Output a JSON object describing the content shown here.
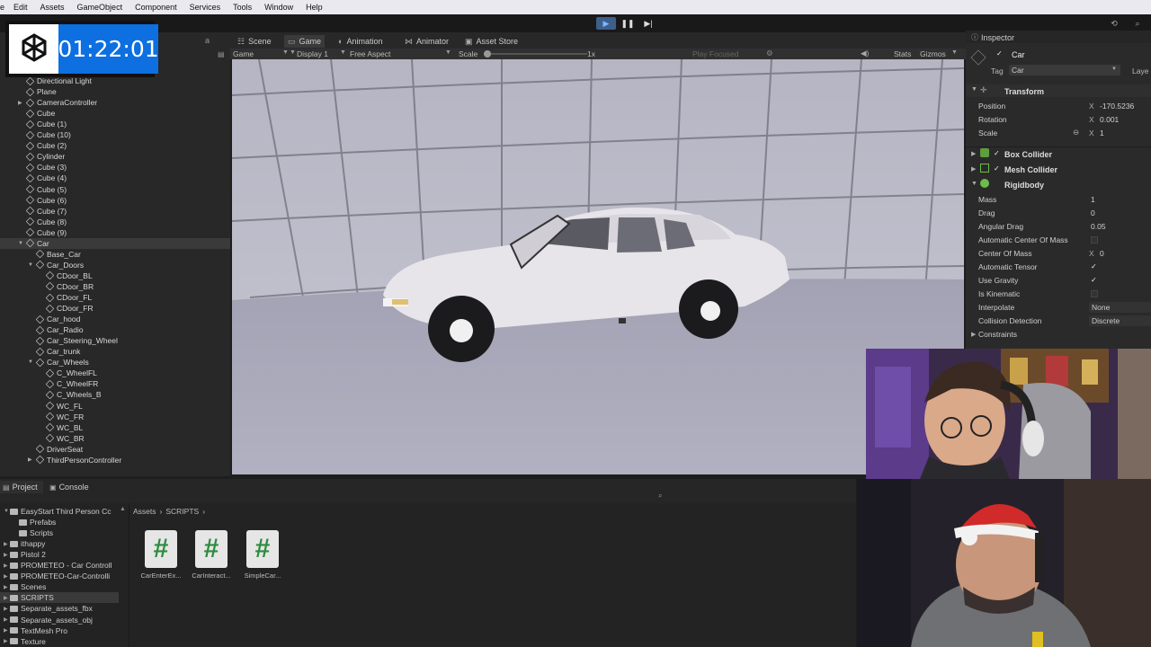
{
  "menu": [
    "e",
    "Edit",
    "Assets",
    "GameObject",
    "Component",
    "Services",
    "Tools",
    "Window",
    "Help"
  ],
  "timer": {
    "value": "01:22:01",
    "logo_icon": "openai-logo-icon"
  },
  "tabs": {
    "scene": "Scene",
    "game": "Game",
    "animation": "Animation",
    "animator": "Animator",
    "asset_store": "Asset Store"
  },
  "gamebar": {
    "game": "Game",
    "display": "Display 1",
    "aspect": "Free Aspect",
    "scale_label": "Scale",
    "scale_value": "1x",
    "play_focused": "Play Focused",
    "stats": "Stats",
    "gizmos": "Gizmos"
  },
  "hierarchy": [
    {
      "label": "Directional Light",
      "indent": 0
    },
    {
      "label": "Plane",
      "indent": 0
    },
    {
      "label": "CameraController",
      "indent": 0,
      "arrow": true
    },
    {
      "label": "Cube",
      "indent": 0
    },
    {
      "label": "Cube (1)",
      "indent": 0
    },
    {
      "label": "Cube (10)",
      "indent": 0
    },
    {
      "label": "Cube (2)",
      "indent": 0
    },
    {
      "label": "Cylinder",
      "indent": 0
    },
    {
      "label": "Cube (3)",
      "indent": 0
    },
    {
      "label": "Cube (4)",
      "indent": 0
    },
    {
      "label": "Cube (5)",
      "indent": 0
    },
    {
      "label": "Cube (6)",
      "indent": 0
    },
    {
      "label": "Cube (7)",
      "indent": 0
    },
    {
      "label": "Cube (8)",
      "indent": 0
    },
    {
      "label": "Cube (9)",
      "indent": 0
    },
    {
      "label": "Car",
      "indent": 0,
      "arrow": true,
      "open": true,
      "selected": true
    },
    {
      "label": "Base_Car",
      "indent": 1
    },
    {
      "label": "Car_Doors",
      "indent": 1,
      "arrow": true,
      "open": true
    },
    {
      "label": "CDoor_BL",
      "indent": 2
    },
    {
      "label": "CDoor_BR",
      "indent": 2
    },
    {
      "label": "CDoor_FL",
      "indent": 2
    },
    {
      "label": "CDoor_FR",
      "indent": 2
    },
    {
      "label": "Car_hood",
      "indent": 1
    },
    {
      "label": "Car_Radio",
      "indent": 1
    },
    {
      "label": "Car_Steering_Wheel",
      "indent": 1
    },
    {
      "label": "Car_trunk",
      "indent": 1
    },
    {
      "label": "Car_Wheels",
      "indent": 1,
      "arrow": true,
      "open": true
    },
    {
      "label": "C_WheelFL",
      "indent": 2
    },
    {
      "label": "C_WheelFR",
      "indent": 2
    },
    {
      "label": "C_Wheels_B",
      "indent": 2
    },
    {
      "label": "WC_FL",
      "indent": 2
    },
    {
      "label": "WC_FR",
      "indent": 2
    },
    {
      "label": "WC_BL",
      "indent": 2
    },
    {
      "label": "WC_BR",
      "indent": 2
    },
    {
      "label": "DriverSeat",
      "indent": 1
    },
    {
      "label": "ThirdPersonController",
      "indent": 1,
      "arrow": true
    }
  ],
  "inspector": {
    "title": "Inspector",
    "object_name": "Car",
    "tag_label": "Tag",
    "tag_value": "Car",
    "layer_label": "Laye",
    "transform": "Transform",
    "position_label": "Position",
    "position_x": "-170.5236",
    "rotation_label": "Rotation",
    "rotation_x": "0.001",
    "scale_label": "Scale",
    "scale_x": "1",
    "axis_x": "X",
    "box_collider": "Box Collider",
    "mesh_collider": "Mesh Collider",
    "rigidbody": "Rigidbody",
    "mass_label": "Mass",
    "mass": "1",
    "drag_label": "Drag",
    "drag": "0",
    "angular_drag_label": "Angular Drag",
    "angular_drag": "0.05",
    "auto_com_label": "Automatic Center Of Mass",
    "com_label": "Center Of Mass",
    "com_x": "0",
    "auto_tensor_label": "Automatic Tensor",
    "use_gravity_label": "Use Gravity",
    "is_kinematic_label": "Is Kinematic",
    "interpolate_label": "Interpolate",
    "interpolate": "None",
    "collision_label": "Collision Detection",
    "collision": "Discrete",
    "constraints_label": "Constraints"
  },
  "bottom": {
    "project_tab": "Project",
    "console_tab": "Console",
    "breadcrumb_assets": "Assets",
    "breadcrumb_scripts": "SCRIPTS",
    "tree": [
      {
        "label": "EasyStart Third Person Cc",
        "indent": 0,
        "open": true
      },
      {
        "label": "Prefabs",
        "indent": 1
      },
      {
        "label": "Scripts",
        "indent": 1
      },
      {
        "label": "ithappy",
        "indent": 0
      },
      {
        "label": "Pistol 2",
        "indent": 0
      },
      {
        "label": "PROMETEO - Car Controll",
        "indent": 0
      },
      {
        "label": "PROMETEO-Car-Controlli",
        "indent": 0
      },
      {
        "label": "Scenes",
        "indent": 0
      },
      {
        "label": "SCRIPTS",
        "indent": 0,
        "selected": true
      },
      {
        "label": "Separate_assets_fbx",
        "indent": 0
      },
      {
        "label": "Separate_assets_obj",
        "indent": 0
      },
      {
        "label": "TextMesh Pro",
        "indent": 0
      },
      {
        "label": "Texture",
        "indent": 0
      }
    ],
    "scripts": [
      "CarEnterEx...",
      "CarInteract...",
      "SimpleCar..."
    ],
    "script_glyph": "#"
  },
  "colors": {
    "accent": "#0d6fe0",
    "selected_row": "#3a3a3a",
    "script_green": "#2e8b3e"
  }
}
